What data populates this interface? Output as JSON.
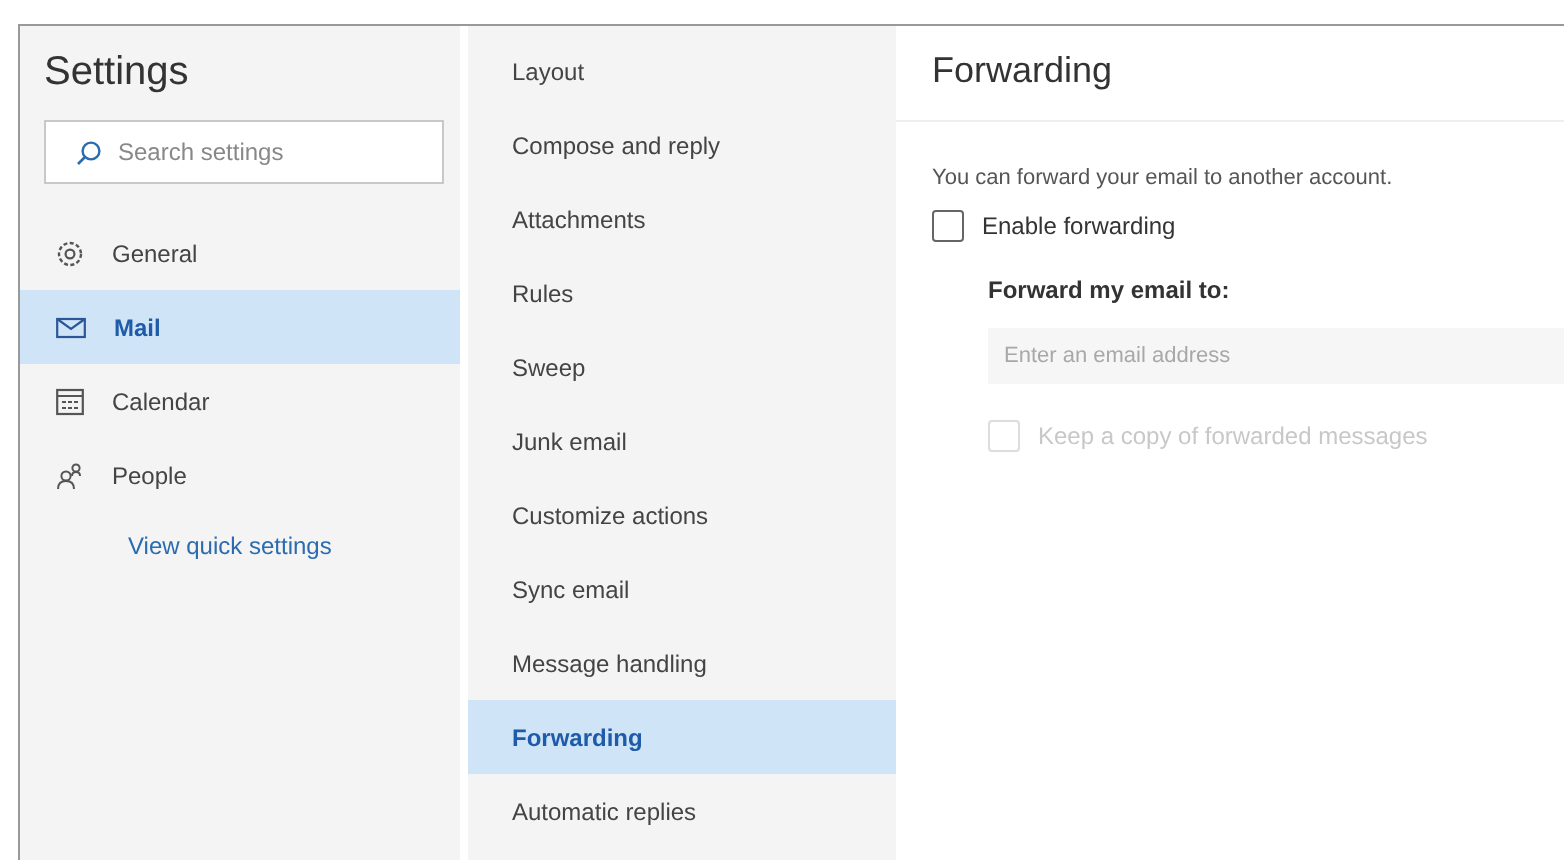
{
  "sidebar": {
    "title": "Settings",
    "search": {
      "placeholder": "Search settings"
    },
    "items": [
      {
        "label": "General",
        "selected": false
      },
      {
        "label": "Mail",
        "selected": true
      },
      {
        "label": "Calendar",
        "selected": false
      },
      {
        "label": "People",
        "selected": false
      }
    ],
    "link": "View quick settings"
  },
  "submenu": [
    {
      "label": "Layout",
      "selected": false
    },
    {
      "label": "Compose and reply",
      "selected": false
    },
    {
      "label": "Attachments",
      "selected": false
    },
    {
      "label": "Rules",
      "selected": false
    },
    {
      "label": "Sweep",
      "selected": false
    },
    {
      "label": "Junk email",
      "selected": false
    },
    {
      "label": "Customize actions",
      "selected": false
    },
    {
      "label": "Sync email",
      "selected": false
    },
    {
      "label": "Message handling",
      "selected": false
    },
    {
      "label": "Forwarding",
      "selected": true
    },
    {
      "label": "Automatic replies",
      "selected": false
    }
  ],
  "page": {
    "title": "Forwarding",
    "description": "You can forward your email to another account.",
    "enable": {
      "label": "Enable forwarding",
      "checked": false
    },
    "forward_label": "Forward my email to:",
    "address": {
      "placeholder": "Enter an email address",
      "disabled": true
    },
    "keep_copy": {
      "label": "Keep a copy of forwarded messages",
      "checked": false,
      "disabled": true
    }
  }
}
